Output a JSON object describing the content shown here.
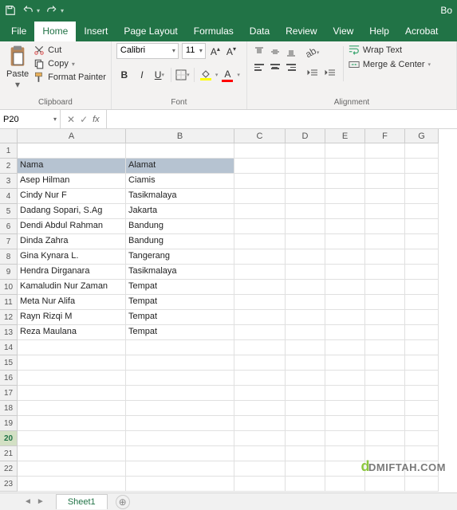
{
  "titlebar": {
    "book": "Bo"
  },
  "tabs": [
    "File",
    "Home",
    "Insert",
    "Page Layout",
    "Formulas",
    "Data",
    "Review",
    "View",
    "Help",
    "Acrobat"
  ],
  "active_tab": 1,
  "ribbon": {
    "clipboard": {
      "paste": "Paste",
      "cut": "Cut",
      "copy": "Copy",
      "fp": "Format Painter",
      "label": "Clipboard"
    },
    "font": {
      "name": "Calibri",
      "size": "11",
      "label": "Font",
      "bold": "B",
      "italic": "I",
      "underline": "U"
    },
    "alignment": {
      "wrap": "Wrap Text",
      "merge": "Merge & Center",
      "label": "Alignment"
    }
  },
  "namebox": "P20",
  "columns": [
    "A",
    "B",
    "C",
    "D",
    "E",
    "F",
    "G"
  ],
  "col_widths": {
    "A": 136,
    "B": 136,
    "C": 64,
    "D": 50,
    "E": 50,
    "F": 50,
    "G": 42
  },
  "rows": [
    {
      "r": 1,
      "A": "",
      "B": ""
    },
    {
      "r": 2,
      "A": "Nama",
      "B": "Alamat",
      "header": true
    },
    {
      "r": 3,
      "A": "Asep Hilman",
      "B": "Ciamis"
    },
    {
      "r": 4,
      "A": "Cindy Nur F",
      "B": "Tasikmalaya"
    },
    {
      "r": 5,
      "A": "Dadang Sopari, S.Ag",
      "B": "Jakarta"
    },
    {
      "r": 6,
      "A": "Dendi Abdul Rahman",
      "B": "Bandung"
    },
    {
      "r": 7,
      "A": "Dinda Zahra",
      "B": "Bandung"
    },
    {
      "r": 8,
      "A": "Gina Kynara L.",
      "B": "Tangerang"
    },
    {
      "r": 9,
      "A": "Hendra Dirganara",
      "B": "Tasikmalaya"
    },
    {
      "r": 10,
      "A": "Kamaludin Nur Zaman",
      "B": "Tempat"
    },
    {
      "r": 11,
      "A": "Meta Nur Alifa",
      "B": "Tempat"
    },
    {
      "r": 12,
      "A": "Rayn Rizqi M",
      "B": "Tempat"
    },
    {
      "r": 13,
      "A": "Reza Maulana",
      "B": "Tempat"
    },
    {
      "r": 14,
      "A": "",
      "B": ""
    },
    {
      "r": 15,
      "A": "",
      "B": ""
    },
    {
      "r": 16,
      "A": "",
      "B": ""
    },
    {
      "r": 17,
      "A": "",
      "B": ""
    },
    {
      "r": 18,
      "A": "",
      "B": ""
    },
    {
      "r": 19,
      "A": "",
      "B": ""
    },
    {
      "r": 20,
      "A": "",
      "B": "",
      "active": true
    },
    {
      "r": 21,
      "A": "",
      "B": ""
    },
    {
      "r": 22,
      "A": "",
      "B": ""
    },
    {
      "r": 23,
      "A": "",
      "B": ""
    }
  ],
  "sheet": "Sheet1",
  "watermark": "DMIFTAH.COM"
}
